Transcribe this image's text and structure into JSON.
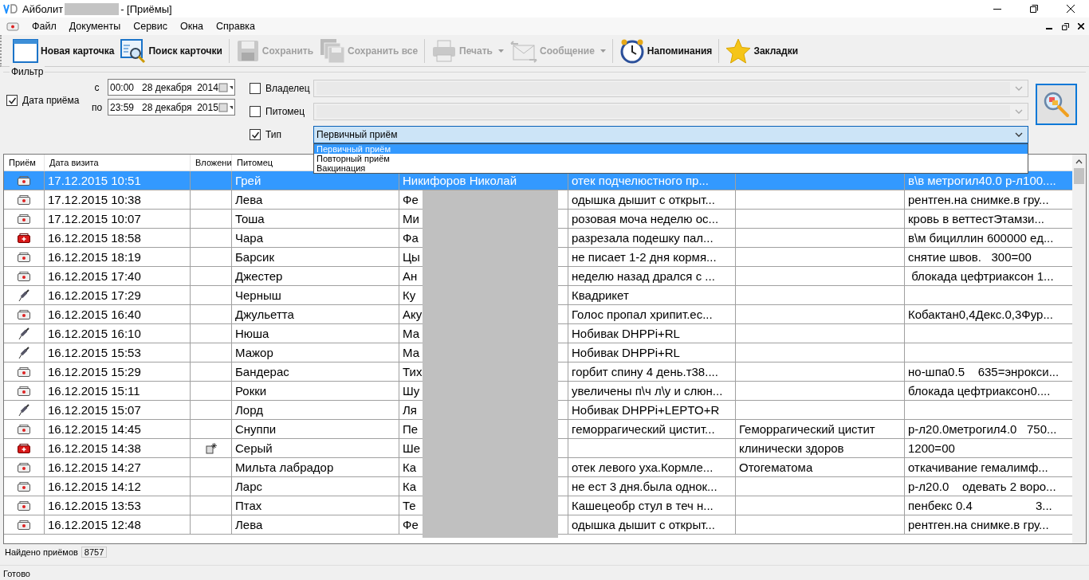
{
  "window": {
    "title": "Айболит",
    "title_suffix": "- [Приёмы]"
  },
  "menu": [
    "Файл",
    "Документы",
    "Сервис",
    "Окна",
    "Справка"
  ],
  "toolbar": [
    {
      "label": "Новая карточка",
      "disabled": false,
      "dropdown": false
    },
    {
      "label": "Поиск карточки",
      "disabled": false,
      "dropdown": false
    },
    {
      "label": "Сохранить",
      "disabled": true,
      "dropdown": false
    },
    {
      "label": "Сохранить все",
      "disabled": true,
      "dropdown": false
    },
    {
      "label": "Печать",
      "disabled": true,
      "dropdown": true
    },
    {
      "label": "Сообщение",
      "disabled": true,
      "dropdown": true
    },
    {
      "label": "Напоминания",
      "disabled": false,
      "dropdown": false
    },
    {
      "label": "Закладки",
      "disabled": false,
      "dropdown": false
    }
  ],
  "filter": {
    "title": "Фильтр",
    "date": {
      "label": "Дата приёма",
      "checked": true,
      "from_label": "с",
      "from": "00:00   28 декабря  2014",
      "to_label": "по",
      "to": "23:59   28 декабря  2015"
    },
    "owner": {
      "label": "Владелец",
      "checked": false
    },
    "pet": {
      "label": "Питомец",
      "checked": false
    },
    "type": {
      "label": "Тип",
      "checked": true,
      "value": "Первичный приём",
      "expanded": true,
      "options": [
        {
          "label": "Первичный приём",
          "selected": true
        },
        {
          "label": "Повторный приём",
          "selected": false
        },
        {
          "label": "Вакцинация",
          "selected": false
        }
      ]
    }
  },
  "table": {
    "columns": [
      "Приём",
      "Дата визита",
      "Вложени",
      "Питомец"
    ],
    "rows": [
      {
        "kind": "visit",
        "attachment": false,
        "selected": true,
        "date": "17.12.2015 10:51",
        "pet": "Грей",
        "owner": "Никифоров Николай",
        "complaint": "отек подчелюстного пр...",
        "diagnosis": "",
        "treatment": "в\\в метрогил40.0 р-л100...."
      },
      {
        "kind": "visit",
        "attachment": false,
        "selected": false,
        "date": "17.12.2015 10:38",
        "pet": "Лева",
        "owner": "Фе",
        "complaint": "одышка дышит с открыт...",
        "diagnosis": "",
        "treatment": "рентген.на снимке.в гру..."
      },
      {
        "kind": "visit",
        "attachment": false,
        "selected": false,
        "date": "17.12.2015 10:07",
        "pet": "Тоша",
        "owner": "Ми",
        "complaint": "розовая моча неделю ос...",
        "diagnosis": "",
        "treatment": "кровь в веттестЭтамзи..."
      },
      {
        "kind": "urgent",
        "attachment": false,
        "selected": false,
        "date": "16.12.2015 18:58",
        "pet": "Чара",
        "owner": "Фа",
        "complaint": "разрезала подешку пал...",
        "diagnosis": "",
        "treatment": "в\\м бициллин 600000 ед..."
      },
      {
        "kind": "visit",
        "attachment": false,
        "selected": false,
        "date": "16.12.2015 18:19",
        "pet": "Барсик",
        "owner": "Цы",
        "complaint": "не писает 1-2 дня кормя...",
        "diagnosis": "",
        "treatment": "снятие швов.   300=00"
      },
      {
        "kind": "visit",
        "attachment": false,
        "selected": false,
        "date": "16.12.2015 17:40",
        "pet": "Джестер",
        "owner": "Ан",
        "complaint": "неделю назад дрался с ...",
        "diagnosis": "",
        "treatment": " блокада цефтриаксон 1..."
      },
      {
        "kind": "vaccination",
        "attachment": false,
        "selected": false,
        "date": "16.12.2015 17:29",
        "pet": "Черныш",
        "owner": "Ку",
        "complaint": "Квадрикет",
        "diagnosis": "",
        "treatment": ""
      },
      {
        "kind": "visit",
        "attachment": false,
        "selected": false,
        "date": "16.12.2015 16:40",
        "pet": "Джульетта",
        "owner": "Аку",
        "complaint": "Голос пропал хрипит.ес...",
        "diagnosis": "",
        "treatment": "Кобактан0,4Декс.0,3Фур..."
      },
      {
        "kind": "vaccination",
        "attachment": false,
        "selected": false,
        "date": "16.12.2015 16:10",
        "pet": "Нюша",
        "owner": "Ма",
        "complaint": "Нобивак DHPPi+RL",
        "diagnosis": "",
        "treatment": ""
      },
      {
        "kind": "vaccination",
        "attachment": false,
        "selected": false,
        "date": "16.12.2015 15:53",
        "pet": "Мажор",
        "owner": "Ма",
        "complaint": "Нобивак DHPPi+RL",
        "diagnosis": "",
        "treatment": ""
      },
      {
        "kind": "visit",
        "attachment": false,
        "selected": false,
        "date": "16.12.2015 15:29",
        "pet": "Бандерас",
        "owner": "Тих",
        "complaint": "горбит спину 4 день.т38....",
        "diagnosis": "",
        "treatment": "но-шпа0.5    635=энрокси..."
      },
      {
        "kind": "visit",
        "attachment": false,
        "selected": false,
        "date": "16.12.2015 15:11",
        "pet": "Рокки",
        "owner": "Шу",
        "complaint": "увеличены п\\ч л\\у и слюн...",
        "diagnosis": "",
        "treatment": "блокада цефтриаксон0...."
      },
      {
        "kind": "vaccination",
        "attachment": false,
        "selected": false,
        "date": "16.12.2015 15:07",
        "pet": "Лорд",
        "owner": "Ля",
        "complaint": "Нобивак DHPPi+LEPTO+R",
        "diagnosis": "",
        "treatment": ""
      },
      {
        "kind": "visit",
        "attachment": false,
        "selected": false,
        "date": "16.12.2015 14:45",
        "pet": "Снуппи",
        "owner": "Пе",
        "complaint": "геморрагический цистит...",
        "diagnosis": "Геморрагический цистит",
        "treatment": "р-л20.0метрогил4.0   750..."
      },
      {
        "kind": "urgent",
        "attachment": true,
        "selected": false,
        "date": "16.12.2015 14:38",
        "pet": "Серый",
        "owner": "Ше",
        "complaint": "",
        "diagnosis": "клинически здоров",
        "treatment": "1200=00"
      },
      {
        "kind": "visit",
        "attachment": false,
        "selected": false,
        "date": "16.12.2015 14:27",
        "pet": "Мильта лабрадор",
        "owner": "Ка",
        "complaint": "отек левого уха.Кормле...",
        "diagnosis": "Отогематома",
        "treatment": "откачивание гемалимф..."
      },
      {
        "kind": "visit",
        "attachment": false,
        "selected": false,
        "date": "16.12.2015 14:12",
        "pet": "Ларс",
        "owner": "Ка",
        "complaint": "не ест 3 дня.была однок...",
        "diagnosis": "",
        "treatment": "р-л20.0    одевать 2 воро..."
      },
      {
        "kind": "visit",
        "attachment": false,
        "selected": false,
        "date": "16.12.2015 13:53",
        "pet": "Птах",
        "owner": "Те",
        "complaint": "Кашецеобр стул в теч н...",
        "diagnosis": "",
        "treatment": "пенбекс 0.4                   3..."
      },
      {
        "kind": "visit",
        "attachment": false,
        "selected": false,
        "date": "16.12.2015 12:48",
        "pet": "Лева",
        "owner": "Фе",
        "complaint": "одышка дышит с открыт...",
        "diagnosis": "",
        "treatment": "рентген.на снимке.в гру..."
      }
    ]
  },
  "found": {
    "label": "Найдено приёмов",
    "count": "8757"
  },
  "status_bar": "Готово"
}
